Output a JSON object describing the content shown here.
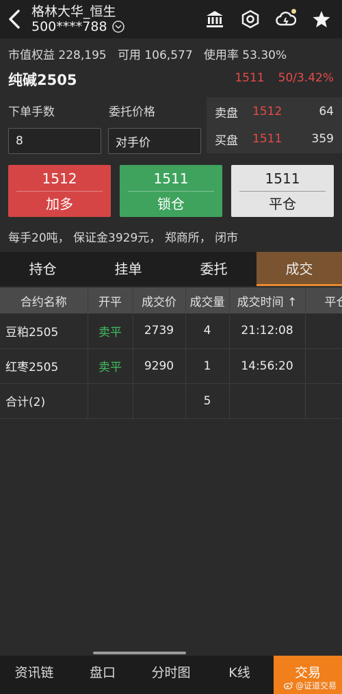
{
  "header": {
    "title": "格林大华_恒生",
    "account": "500****788"
  },
  "account_info": {
    "equity_label": "市值权益",
    "equity_value": "228,195",
    "available_label": "可用",
    "available_value": "106,577",
    "usage_label": "使用率",
    "usage_value": "53.30%"
  },
  "contract": {
    "name": "纯碱2505",
    "last_price": "1511",
    "change": "50/3.42%"
  },
  "order_form": {
    "qty_label": "下单手数",
    "qty_value": "8",
    "price_label": "委托价格",
    "price_value": "对手价"
  },
  "order_book": {
    "ask_label": "卖盘",
    "ask_price": "1512",
    "ask_vol": "64",
    "bid_label": "买盘",
    "bid_price": "1511",
    "bid_vol": "359"
  },
  "actions": {
    "buy_price": "1512",
    "buy_label": "加多",
    "lock_price": "1511",
    "lock_label": "锁仓",
    "close_price": "1511",
    "close_label": "平仓"
  },
  "note": "每手20吨， 保证金3929元， 郑商所， 闭市",
  "tabs": [
    "持仓",
    "挂单",
    "委托",
    "成交"
  ],
  "table": {
    "headers": [
      "合约名称",
      "开平",
      "成交价",
      "成交量",
      "成交时间 ↑",
      "平仓"
    ],
    "rows": [
      [
        "豆粕2505",
        "卖平",
        "2739",
        "4",
        "21:12:08",
        ""
      ],
      [
        "红枣2505",
        "卖平",
        "9290",
        "1",
        "14:56:20",
        ""
      ],
      [
        "合计(2)",
        "",
        "",
        "5",
        "",
        ""
      ]
    ]
  },
  "bottom_nav": [
    "资讯链",
    "盘口",
    "分时图",
    "K线",
    "交易"
  ],
  "watermark": "@证道交易",
  "colors": {
    "up_red": "#e84a4a",
    "green": "#3fbf5f",
    "accent_orange": "#f07f1c"
  }
}
